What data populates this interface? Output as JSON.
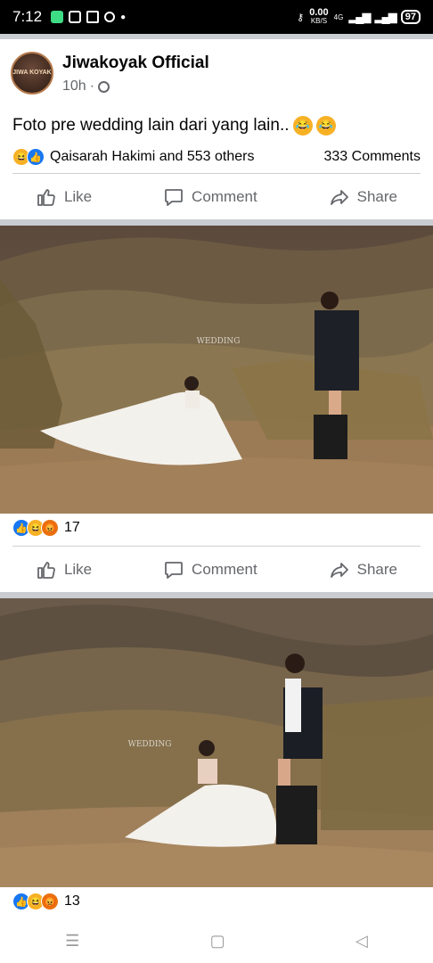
{
  "status_bar": {
    "time": "7:12",
    "net_speed": "0.00",
    "net_unit": "KB/S",
    "network": "4G",
    "battery": "97"
  },
  "post": {
    "page_name": "Jiwakoyak Official",
    "avatar_text": "JIWA KOYAK",
    "time": "10h",
    "caption": "Foto pre wedding lain dari yang lain..",
    "reactions_names": "Qaisarah Hakimi and 553 others",
    "comments_count": "333 Comments",
    "actions": {
      "like": "Like",
      "comment": "Comment",
      "share": "Share"
    }
  },
  "photos": [
    {
      "reaction_count": "17",
      "watermark": "WEDDING"
    },
    {
      "reaction_count": "13",
      "watermark": "WEDDING"
    }
  ],
  "nav": {
    "recent": "☰",
    "home": "▢",
    "back": "◁"
  },
  "colors": {
    "accent": "#1877f2",
    "haha": "#f7b125",
    "angry": "#e9710f"
  }
}
